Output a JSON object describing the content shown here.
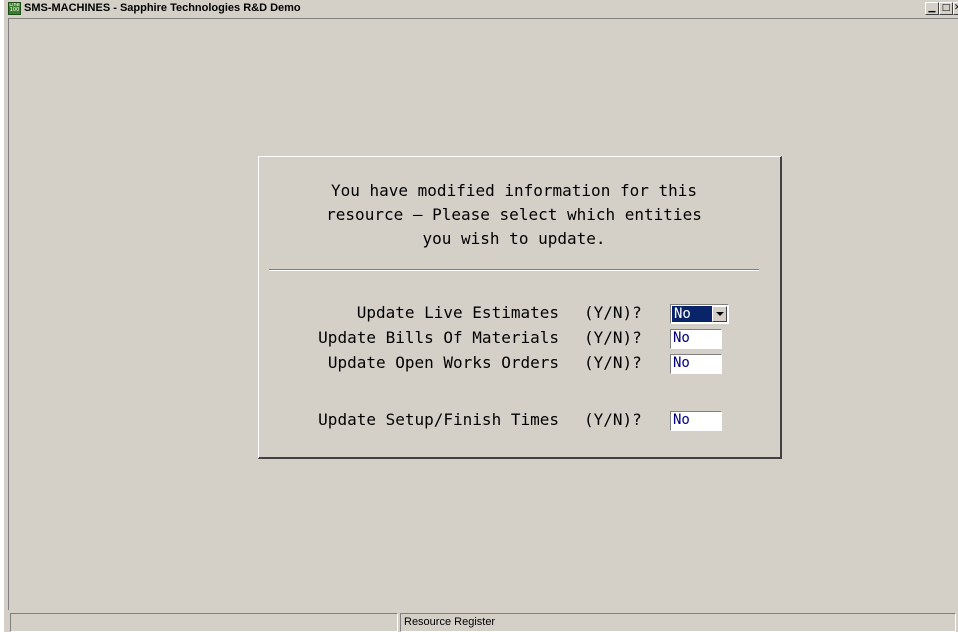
{
  "window": {
    "title": "SMS-MACHINES - Sapphire Technologies R&D Demo",
    "icon_text_top": "Line",
    "icon_text_bottom": "100"
  },
  "dialog": {
    "message_lines": [
      "You have modified information for this",
      "resource — Please select which entities",
      "you wish to update."
    ],
    "rows": [
      {
        "label": "Update Live Estimates",
        "yn": "(Y/N)?",
        "value": "No"
      },
      {
        "label": "Update Bills Of Materials",
        "yn": "(Y/N)?",
        "value": "No"
      },
      {
        "label": "Update Open Works Orders",
        "yn": "(Y/N)?",
        "value": "No"
      },
      {
        "label": "Update Setup/Finish Times",
        "yn": "(Y/N)?",
        "value": "No"
      }
    ]
  },
  "statusbar": {
    "pane1": "",
    "pane2": "Resource Register"
  },
  "colors": {
    "face": "#d4d0c8",
    "selection": "#0a246a",
    "field_text": "#000080"
  }
}
